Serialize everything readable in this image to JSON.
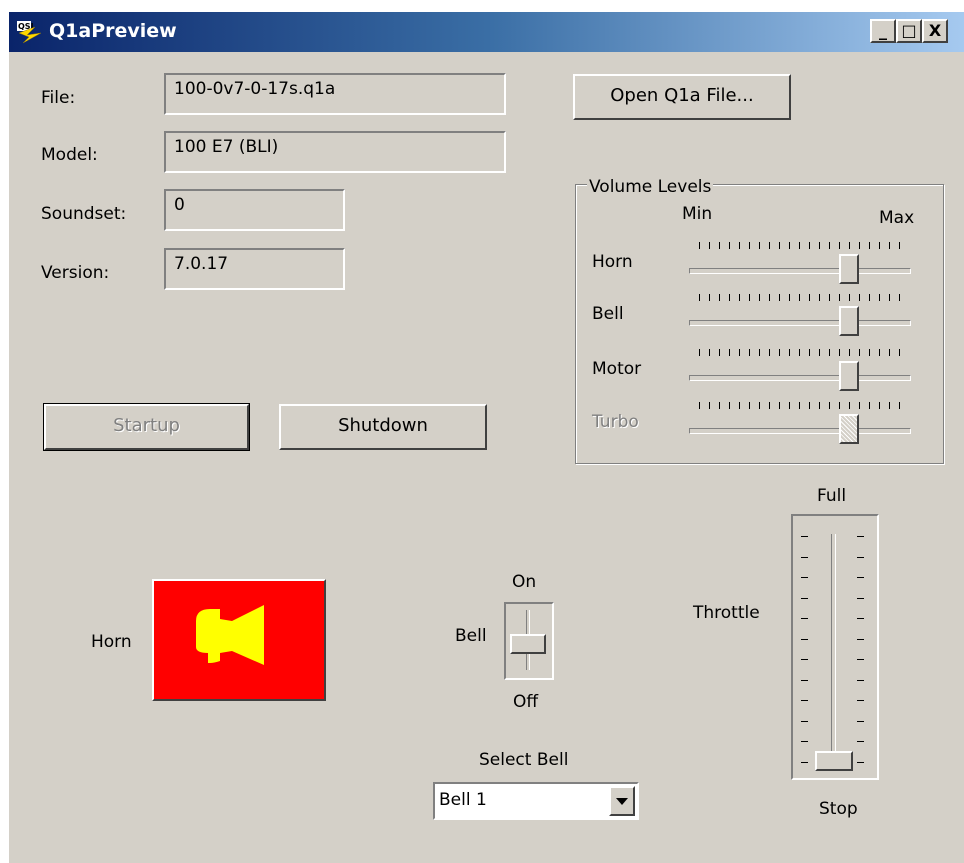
{
  "window": {
    "title": "Q1aPreview",
    "minimize": "_",
    "maximize": "□",
    "close": "X"
  },
  "fields": {
    "file_label": "File:",
    "file_value": "100-0v7-0-17s.q1a",
    "model_label": "Model:",
    "model_value": "100 E7 (BLI)",
    "soundset_label": "Soundset:",
    "soundset_value": "0",
    "version_label": "Version:",
    "version_value": "7.0.17"
  },
  "buttons": {
    "open": "Open Q1a File...",
    "startup": "Startup",
    "shutdown": "Shutdown"
  },
  "volume": {
    "group_title": "Volume Levels",
    "min_label": "Min",
    "max_label": "Max",
    "sliders": [
      {
        "label": "Horn",
        "value": 0.75,
        "enabled": true
      },
      {
        "label": "Bell",
        "value": 0.75,
        "enabled": true
      },
      {
        "label": "Motor",
        "value": 0.75,
        "enabled": true
      },
      {
        "label": "Turbo",
        "value": 0.75,
        "enabled": false
      }
    ]
  },
  "horn": {
    "label": "Horn",
    "icon": "horn-icon",
    "color": "#ff0000",
    "icon_color": "#ffff00"
  },
  "bell": {
    "label": "Bell",
    "on_label": "On",
    "off_label": "Off",
    "state": "off"
  },
  "select_bell": {
    "label": "Select Bell",
    "value": "Bell 1"
  },
  "throttle": {
    "label": "Throttle",
    "full_label": "Full",
    "stop_label": "Stop",
    "value": 0
  }
}
